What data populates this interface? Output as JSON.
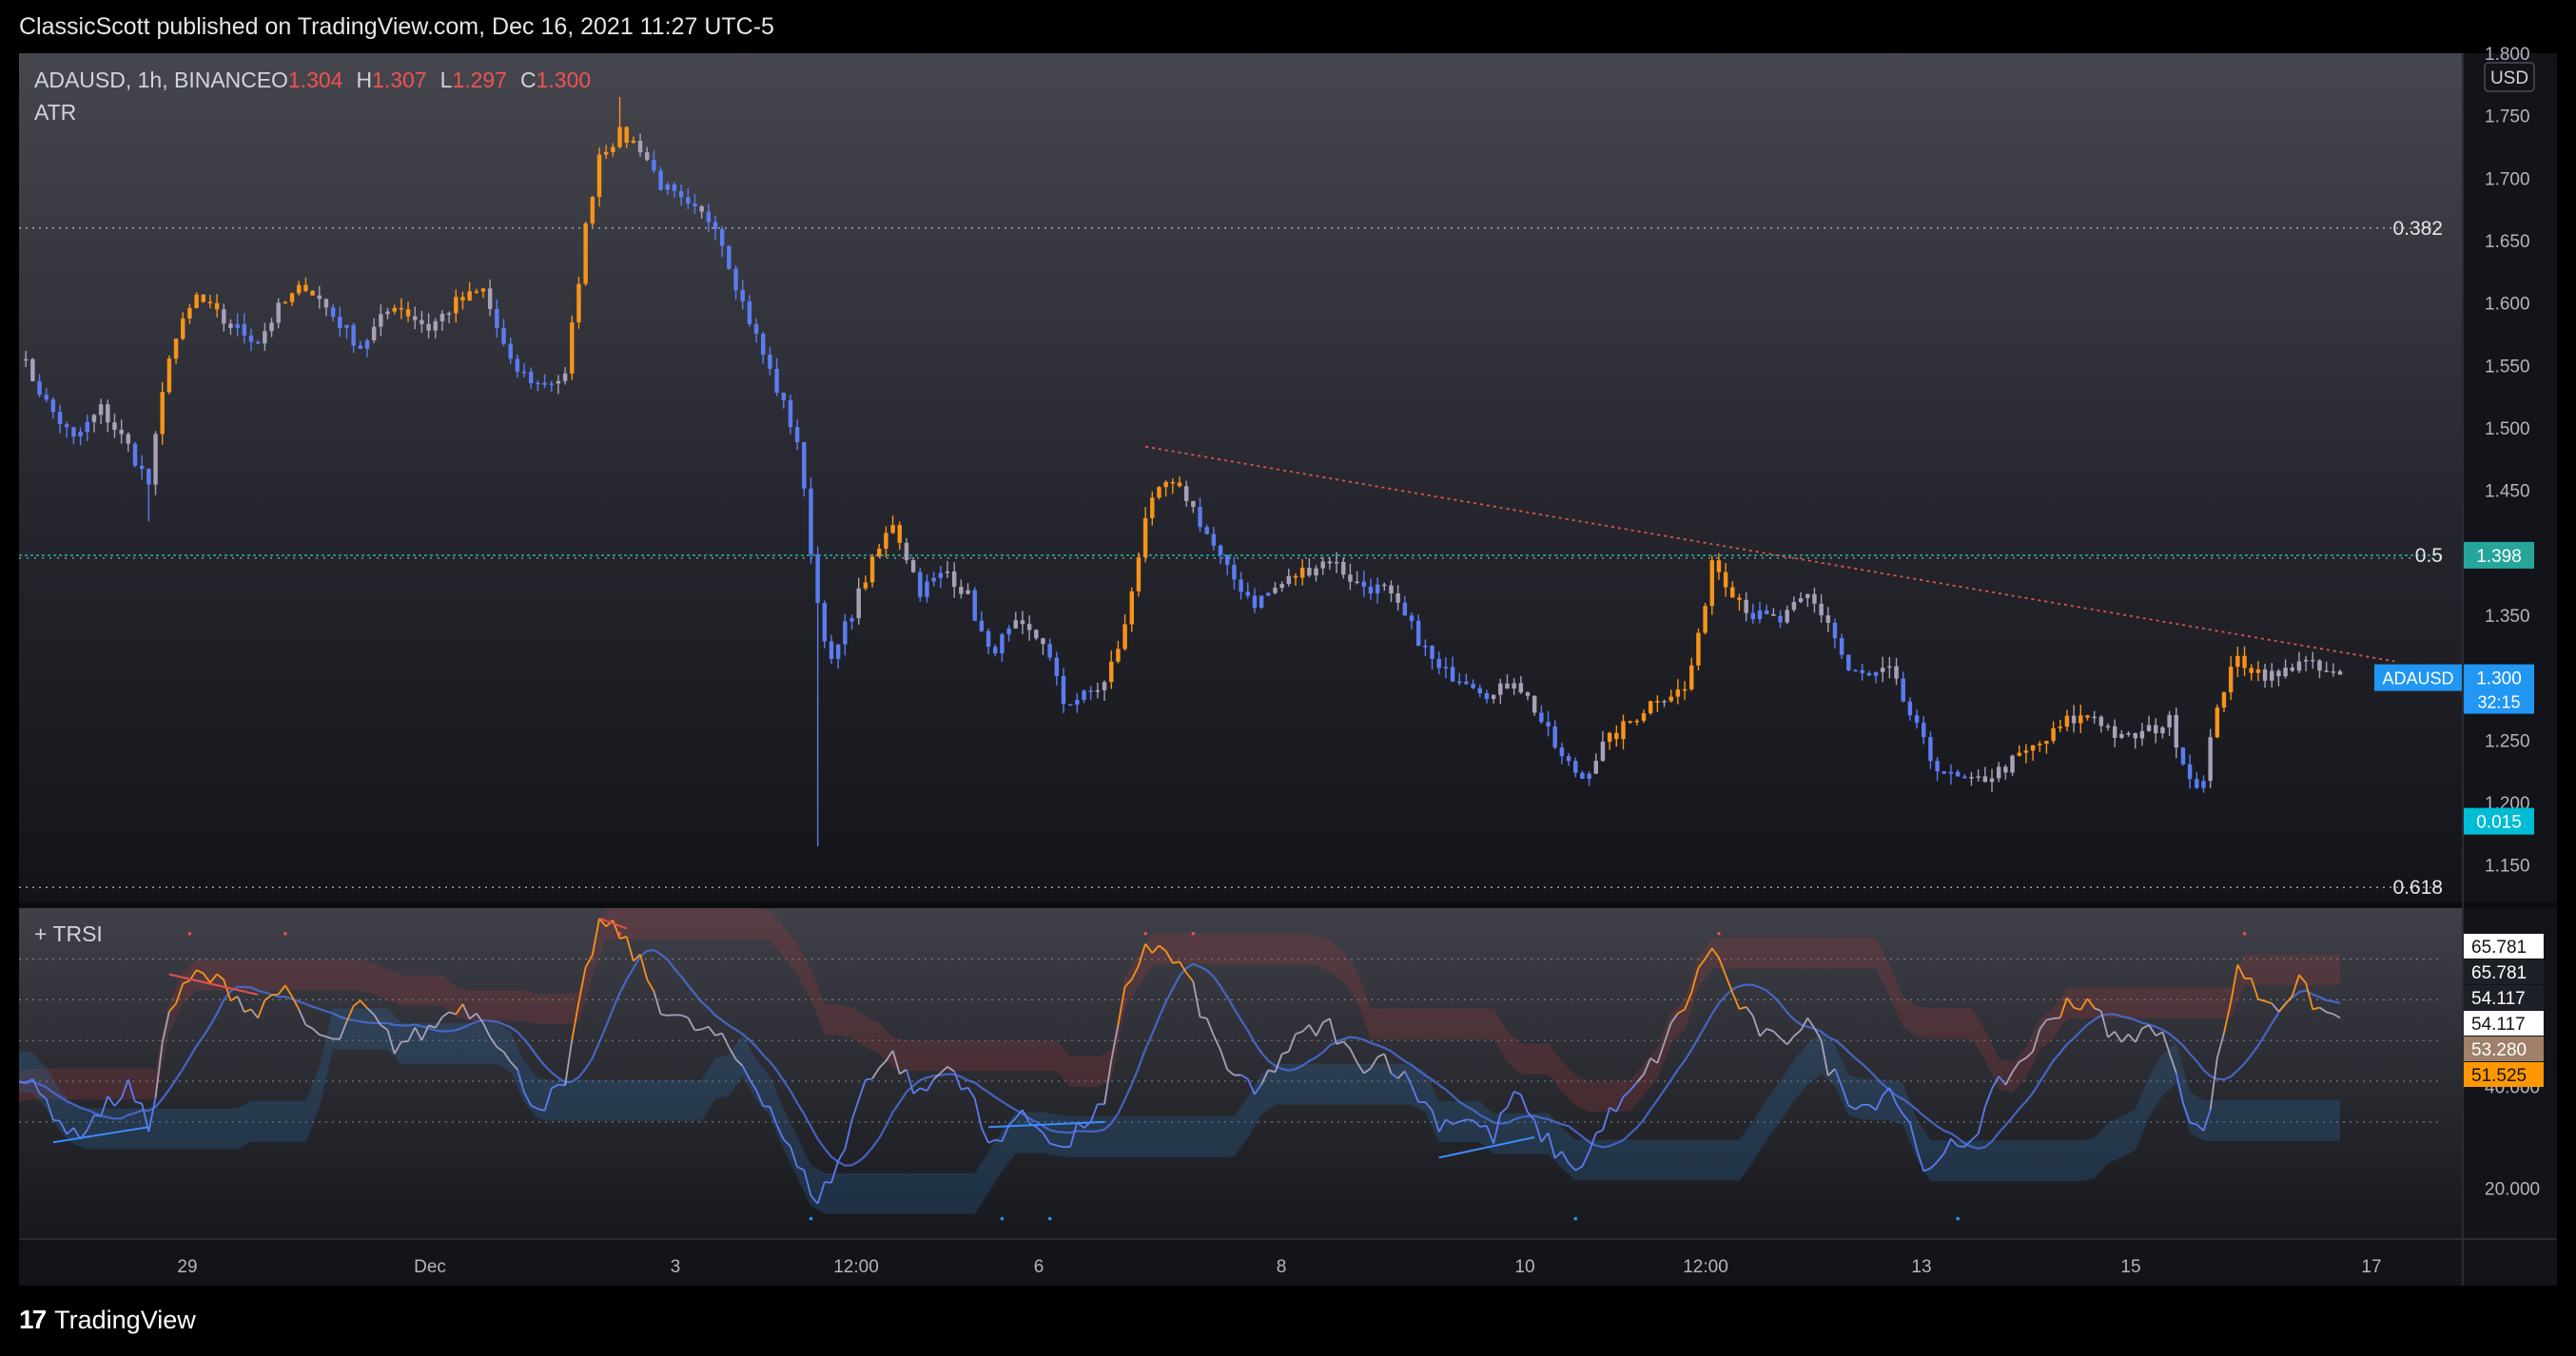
{
  "header": {
    "published": "ClassicScott published on TradingView.com, Dec 16, 2021 11:27 UTC-5"
  },
  "footer": {
    "brand": "TradingView",
    "brand_mark": "17"
  },
  "legend": {
    "symbol": "ADAUSD, 1h, BINANCE",
    "o_label": "O",
    "o_value": "1.304",
    "h_label": "H",
    "h_value": "1.307",
    "l_label": "L",
    "l_value": "1.297",
    "c_label": "C",
    "c_value": "1.300",
    "indicator": "ATR",
    "lower_indicator": "+ TRSI"
  },
  "colors": {
    "bull": "#f7931a",
    "bear": "#5b7cf0",
    "neutral": "#a8a0b8",
    "grid_dotted": "#9aa0a6",
    "teal": "#26a69a",
    "trend": "#e0524c",
    "price_badge": "#2196f3",
    "atr_badge": "#00bcd4",
    "orange_badge": "#ff9800"
  },
  "chart_data": [
    {
      "type": "candlestick",
      "symbol": "ADAUSD",
      "interval": "1h",
      "exchange": "BINANCE",
      "currency_label": "USD",
      "ylim": [
        1.12,
        1.8
      ],
      "y_ticks": [
        "1.800",
        "1.750",
        "1.700",
        "1.650",
        "1.600",
        "1.550",
        "1.500",
        "1.450",
        "1.400",
        "1.350",
        "1.300",
        "1.250",
        "1.200",
        "1.150"
      ],
      "x_ticks": [
        "29",
        "Dec",
        "3",
        "12:00",
        "6",
        "8",
        "10",
        "12:00",
        "13",
        "15",
        "17"
      ],
      "price_path": [
        [
          0,
          1.56
        ],
        [
          4,
          1.52
        ],
        [
          8,
          1.49
        ],
        [
          12,
          1.515
        ],
        [
          16,
          1.485
        ],
        [
          19,
          1.455
        ],
        [
          22,
          1.56
        ],
        [
          26,
          1.605
        ],
        [
          30,
          1.585
        ],
        [
          35,
          1.57
        ],
        [
          38,
          1.595
        ],
        [
          42,
          1.615
        ],
        [
          46,
          1.59
        ],
        [
          50,
          1.565
        ],
        [
          55,
          1.6
        ],
        [
          60,
          1.58
        ],
        [
          64,
          1.6
        ],
        [
          68,
          1.61
        ],
        [
          72,
          1.55
        ],
        [
          76,
          1.535
        ],
        [
          80,
          1.54
        ],
        [
          83,
          1.66
        ],
        [
          85,
          1.72
        ],
        [
          88,
          1.735
        ],
        [
          91,
          1.725
        ],
        [
          94,
          1.695
        ],
        [
          98,
          1.675
        ],
        [
          102,
          1.665
        ],
        [
          106,
          1.6
        ],
        [
          110,
          1.545
        ],
        [
          114,
          1.49
        ],
        [
          117,
          1.36
        ],
        [
          119,
          1.31
        ],
        [
          121,
          1.34
        ],
        [
          124,
          1.38
        ],
        [
          128,
          1.425
        ],
        [
          132,
          1.37
        ],
        [
          136,
          1.385
        ],
        [
          139,
          1.365
        ],
        [
          142,
          1.32
        ],
        [
          146,
          1.34
        ],
        [
          150,
          1.33
        ],
        [
          153,
          1.28
        ],
        [
          156,
          1.285
        ],
        [
          159,
          1.295
        ],
        [
          162,
          1.34
        ],
        [
          165,
          1.43
        ],
        [
          168,
          1.455
        ],
        [
          171,
          1.445
        ],
        [
          174,
          1.415
        ],
        [
          177,
          1.385
        ],
        [
          181,
          1.36
        ],
        [
          185,
          1.375
        ],
        [
          188,
          1.385
        ],
        [
          192,
          1.395
        ],
        [
          196,
          1.375
        ],
        [
          200,
          1.37
        ],
        [
          204,
          1.34
        ],
        [
          208,
          1.305
        ],
        [
          212,
          1.3
        ],
        [
          216,
          1.285
        ],
        [
          219,
          1.3
        ],
        [
          222,
          1.275
        ],
        [
          226,
          1.235
        ],
        [
          229,
          1.22
        ],
        [
          232,
          1.245
        ],
        [
          236,
          1.265
        ],
        [
          240,
          1.285
        ],
        [
          244,
          1.29
        ],
        [
          246,
          1.33
        ],
        [
          248,
          1.395
        ],
        [
          251,
          1.37
        ],
        [
          254,
          1.35
        ],
        [
          258,
          1.345
        ],
        [
          262,
          1.365
        ],
        [
          265,
          1.345
        ],
        [
          268,
          1.305
        ],
        [
          271,
          1.3
        ],
        [
          274,
          1.305
        ],
        [
          277,
          1.27
        ],
        [
          280,
          1.235
        ],
        [
          283,
          1.22
        ],
        [
          286,
          1.215
        ],
        [
          290,
          1.225
        ],
        [
          294,
          1.24
        ],
        [
          297,
          1.25
        ],
        [
          300,
          1.265
        ],
        [
          304,
          1.27
        ],
        [
          308,
          1.25
        ],
        [
          311,
          1.255
        ],
        [
          315,
          1.265
        ],
        [
          318,
          1.22
        ],
        [
          320,
          1.215
        ],
        [
          322,
          1.28
        ],
        [
          325,
          1.315
        ],
        [
          328,
          1.305
        ],
        [
          331,
          1.3
        ],
        [
          334,
          1.315
        ],
        [
          337,
          1.305
        ],
        [
          340,
          1.3
        ]
      ],
      "last_price": "1.300",
      "countdown": "32:15",
      "atr_value": "0.015",
      "horizontal_level": {
        "label": "0.5",
        "value": "1.398"
      },
      "fib_levels": [
        {
          "label": "0.382",
          "price": 1.66
        },
        {
          "label": "0.5",
          "price": 1.398
        },
        {
          "label": "0.618",
          "price": 1.132
        }
      ],
      "trendline": {
        "start": [
          165,
          1.485
        ],
        "end": [
          348,
          1.313
        ]
      }
    },
    {
      "type": "line",
      "title": "+ TRSI",
      "ylim": [
        10,
        75
      ],
      "y_ticks": [
        "40.000",
        "20.000"
      ],
      "value_badges": [
        "65.781",
        "65.781",
        "54.117",
        "54.117",
        "53.280",
        "51.525"
      ],
      "series": [
        {
          "values": [
            [
              0,
              42
            ],
            [
              4,
              37
            ],
            [
              8,
              30
            ],
            [
              12,
              35
            ],
            [
              16,
              40
            ],
            [
              19,
              32
            ],
            [
              22,
              55
            ],
            [
              26,
              62
            ],
            [
              30,
              60
            ],
            [
              35,
              54
            ],
            [
              38,
              60
            ],
            [
              42,
              52
            ],
            [
              46,
              48
            ],
            [
              50,
              56
            ],
            [
              55,
              48
            ],
            [
              60,
              51
            ],
            [
              64,
              56
            ],
            [
              68,
              54
            ],
            [
              72,
              44
            ],
            [
              76,
              36
            ],
            [
              80,
              40
            ],
            [
              83,
              62
            ],
            [
              85,
              72
            ],
            [
              88,
              70
            ],
            [
              91,
              64
            ],
            [
              94,
              56
            ],
            [
              98,
              52
            ],
            [
              102,
              50
            ],
            [
              106,
              44
            ],
            [
              110,
              36
            ],
            [
              114,
              24
            ],
            [
              117,
              18
            ],
            [
              119,
              22
            ],
            [
              121,
              28
            ],
            [
              124,
              42
            ],
            [
              128,
              46
            ],
            [
              132,
              38
            ],
            [
              136,
              44
            ],
            [
              139,
              40
            ],
            [
              142,
              28
            ],
            [
              146,
              34
            ],
            [
              150,
              32
            ],
            [
              153,
              27
            ],
            [
              156,
              33
            ],
            [
              159,
              36
            ],
            [
              162,
              58
            ],
            [
              165,
              68
            ],
            [
              168,
              66
            ],
            [
              171,
              62
            ],
            [
              174,
              52
            ],
            [
              177,
              44
            ],
            [
              181,
              38
            ],
            [
              185,
              46
            ],
            [
              188,
              50
            ],
            [
              192,
              52
            ],
            [
              196,
              44
            ],
            [
              200,
              46
            ],
            [
              204,
              40
            ],
            [
              208,
              33
            ],
            [
              212,
              34
            ],
            [
              216,
              30
            ],
            [
              219,
              39
            ],
            [
              222,
              32
            ],
            [
              226,
              26
            ],
            [
              229,
              24
            ],
            [
              232,
              33
            ],
            [
              236,
              38
            ],
            [
              240,
              46
            ],
            [
              244,
              56
            ],
            [
              246,
              62
            ],
            [
              248,
              68
            ],
            [
              251,
              58
            ],
            [
              254,
              52
            ],
            [
              258,
              48
            ],
            [
              262,
              54
            ],
            [
              265,
              44
            ],
            [
              268,
              38
            ],
            [
              271,
              36
            ],
            [
              274,
              40
            ],
            [
              277,
              32
            ],
            [
              280,
              22
            ],
            [
              283,
              28
            ],
            [
              286,
              30
            ],
            [
              290,
              40
            ],
            [
              294,
              46
            ],
            [
              297,
              52
            ],
            [
              300,
              57
            ],
            [
              304,
              55
            ],
            [
              308,
              48
            ],
            [
              311,
              52
            ],
            [
              315,
              48
            ],
            [
              318,
              34
            ],
            [
              320,
              30
            ],
            [
              322,
              44
            ],
            [
              325,
              64
            ],
            [
              328,
              58
            ],
            [
              331,
              56
            ],
            [
              334,
              60
            ],
            [
              337,
              55
            ],
            [
              340,
              53
            ]
          ]
        }
      ]
    }
  ]
}
